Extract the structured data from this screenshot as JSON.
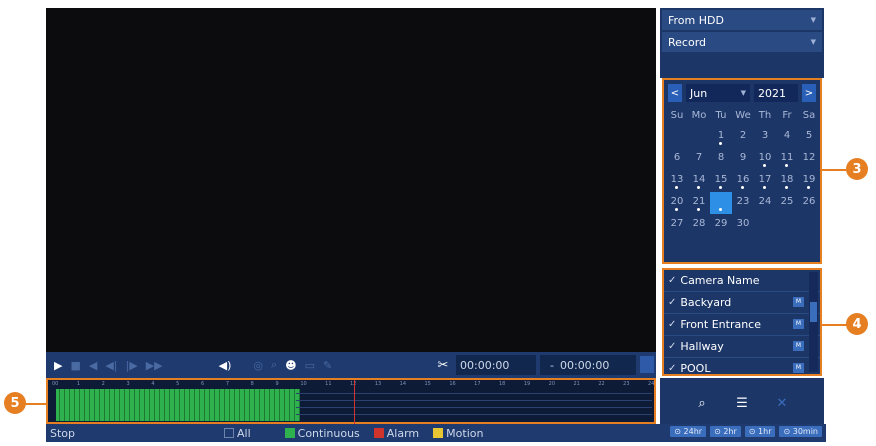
{
  "source_dropdown": {
    "value": "From HDD"
  },
  "mode_dropdown": {
    "value": "Record"
  },
  "calendar": {
    "month": "Jun",
    "year": "2021",
    "prev": "<",
    "next": ">",
    "weekdays": [
      "Su",
      "Mo",
      "Tu",
      "We",
      "Th",
      "Fr",
      "Sa"
    ],
    "selected_day": 22,
    "recorded_days": [
      1,
      10,
      11,
      13,
      14,
      15,
      16,
      17,
      18,
      19,
      20,
      21,
      22
    ]
  },
  "camera_list": {
    "header": "Camera Name",
    "items": [
      "Backyard",
      "Front Entrance",
      "Hallway",
      "POOL"
    ],
    "m_label": "M"
  },
  "playback": {
    "start_time": "00:00:00",
    "end_time": "00:00:00"
  },
  "timeline": {
    "hour_labels": [
      "00",
      "1",
      "2",
      "3",
      "4",
      "5",
      "6",
      "7",
      "8",
      "9",
      "10",
      "11",
      "12",
      "13",
      "14",
      "15",
      "16",
      "17",
      "18",
      "19",
      "20",
      "21",
      "22",
      "23",
      "24"
    ],
    "recorded_hours": [
      0,
      9.8
    ],
    "cursor_hour": 12
  },
  "status": {
    "state": "Stop",
    "legend": [
      {
        "label": "All",
        "color": "#1e3a6e"
      },
      {
        "label": "Continuous",
        "color": "#2fb14d"
      },
      {
        "label": "Alarm",
        "color": "#d0342c"
      },
      {
        "label": "Motion",
        "color": "#e8c532"
      }
    ],
    "speeds": [
      "24hr",
      "2hr",
      "1hr",
      "30min"
    ]
  },
  "callouts": [
    "3",
    "4",
    "5"
  ]
}
